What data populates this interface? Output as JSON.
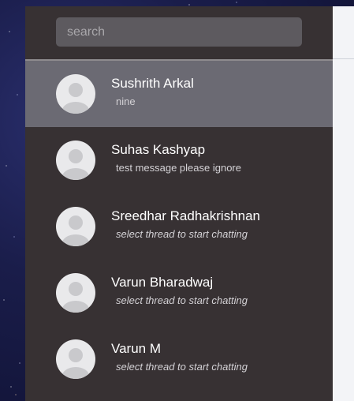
{
  "search": {
    "placeholder": "search",
    "value": ""
  },
  "threads": [
    {
      "name": "Sushrith Arkal",
      "preview": "nine",
      "active": true,
      "preview_italic": false
    },
    {
      "name": "Suhas Kashyap",
      "preview": "test message please ignore",
      "active": false,
      "preview_italic": false
    },
    {
      "name": "Sreedhar Radhakrishnan",
      "preview": "select thread to start chatting",
      "active": false,
      "preview_italic": true
    },
    {
      "name": "Varun Bharadwaj",
      "preview": "select thread to start chatting",
      "active": false,
      "preview_italic": true
    },
    {
      "name": "Varun M",
      "preview": "select thread to start chatting",
      "active": false,
      "preview_italic": true
    }
  ],
  "colors": {
    "sidebar_bg": "#373133",
    "active_thread_bg": "#6b6a73",
    "search_bg": "#5d5a5f",
    "right_panel_bg": "#f3f4f7",
    "avatar_bg": "#e9e9eb",
    "avatar_fg": "#c9c9cc"
  },
  "icons": {
    "avatar": "person-silhouette-icon"
  }
}
